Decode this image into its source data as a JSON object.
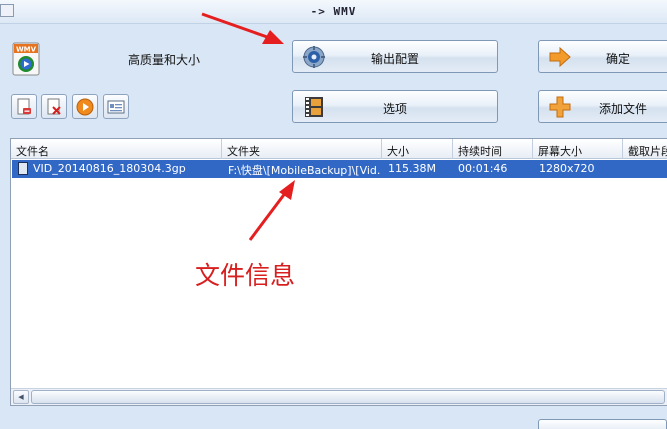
{
  "window": {
    "title": "-> WMV"
  },
  "profile": {
    "quality_label": "高质量和大小",
    "logo_text": "WMV"
  },
  "buttons": {
    "output_config": "输出配置",
    "options": "选项",
    "ok": "确定",
    "add_file": "添加文件"
  },
  "toolbar": {
    "icons": [
      "remove-file-icon",
      "delete-icon",
      "play-icon",
      "media-info-icon"
    ]
  },
  "file_list": {
    "columns": [
      "文件名",
      "文件夹",
      "大小",
      "持续时间",
      "屏幕大小",
      "截取片段"
    ],
    "rows": [
      {
        "name": "VID_20140816_180304.3gp",
        "folder": "F:\\快盘\\[MobileBackup]\\[Vid...",
        "size": "115.38M",
        "duration": "00:01:46",
        "screen_size": "1280x720"
      }
    ]
  },
  "annotation": {
    "text": "文件信息",
    "color": "#d81e1e"
  },
  "colors": {
    "selection": "#3168c6",
    "background": "#d9e6f5"
  }
}
